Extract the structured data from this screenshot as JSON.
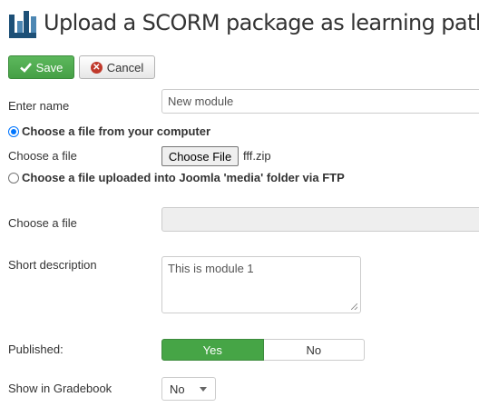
{
  "header": {
    "title": "Upload a SCORM package as learning path",
    "logo_icon": "joomla-learning-logo"
  },
  "toolbar": {
    "save_label": "Save",
    "save_icon": "check-icon",
    "cancel_label": "Cancel",
    "cancel_icon": "cancel-circle-icon",
    "cancel_icon_glyph": "✕"
  },
  "form": {
    "name_label": "Enter name",
    "name_value": "New module",
    "radio_computer_label": "Choose a file from your computer",
    "radio_computer_selected": true,
    "file_label": "Choose a file",
    "file_button_label": "Choose File",
    "file_name": "fff.zip",
    "radio_ftp_label": "Choose a file uploaded into Joomla 'media' folder via FTP",
    "radio_ftp_selected": false,
    "ftp_file_label": "Choose a file",
    "ftp_file_value": "",
    "short_desc_label": "Short description",
    "short_desc_value": "This is module 1",
    "published_label": "Published:",
    "published_yes": "Yes",
    "published_no": "No",
    "published_value": "Yes",
    "gradebook_label": "Show in Gradebook",
    "gradebook_value": "No"
  },
  "colors": {
    "save_green": "#5cb85c",
    "toggle_green": "#46a546",
    "radio_blue": "#0075ff",
    "logo_blue": "#1d5077"
  }
}
